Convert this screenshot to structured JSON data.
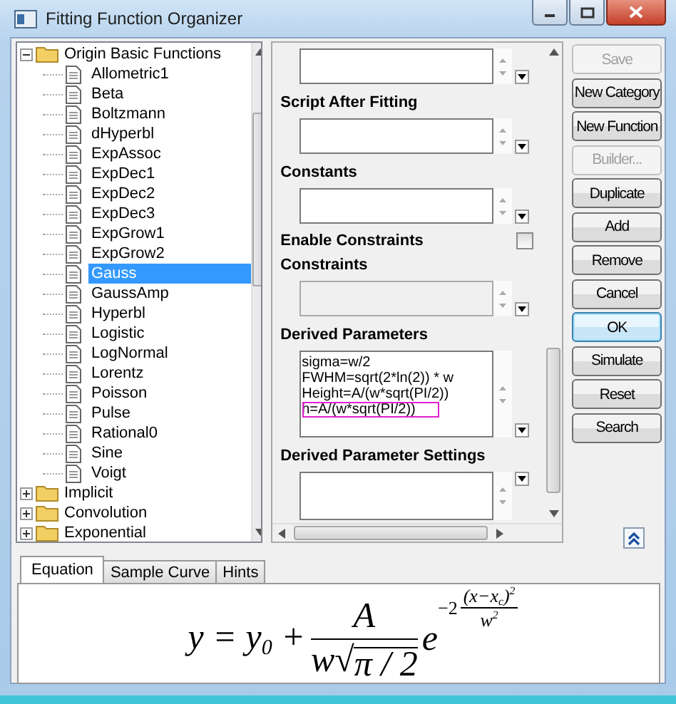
{
  "window": {
    "title": "Fitting Function Organizer"
  },
  "tree": [
    {
      "label": "Origin Basic Functions",
      "kind": "folder",
      "expanded": true,
      "selected": false,
      "children": [
        {
          "label": "Allometric1",
          "kind": "file",
          "selected": false
        },
        {
          "label": "Beta",
          "kind": "file",
          "selected": false
        },
        {
          "label": "Boltzmann",
          "kind": "file",
          "selected": false
        },
        {
          "label": "dHyperbl",
          "kind": "file",
          "selected": false
        },
        {
          "label": "ExpAssoc",
          "kind": "file",
          "selected": false
        },
        {
          "label": "ExpDec1",
          "kind": "file",
          "selected": false
        },
        {
          "label": "ExpDec2",
          "kind": "file",
          "selected": false
        },
        {
          "label": "ExpDec3",
          "kind": "file",
          "selected": false
        },
        {
          "label": "ExpGrow1",
          "kind": "file",
          "selected": false
        },
        {
          "label": "ExpGrow2",
          "kind": "file",
          "selected": false
        },
        {
          "label": "Gauss",
          "kind": "file",
          "selected": true
        },
        {
          "label": "GaussAmp",
          "kind": "file",
          "selected": false
        },
        {
          "label": "Hyperbl",
          "kind": "file",
          "selected": false
        },
        {
          "label": "Logistic",
          "kind": "file",
          "selected": false
        },
        {
          "label": "LogNormal",
          "kind": "file",
          "selected": false
        },
        {
          "label": "Lorentz",
          "kind": "file",
          "selected": false
        },
        {
          "label": "Poisson",
          "kind": "file",
          "selected": false
        },
        {
          "label": "Pulse",
          "kind": "file",
          "selected": false
        },
        {
          "label": "Rational0",
          "kind": "file",
          "selected": false
        },
        {
          "label": "Sine",
          "kind": "file",
          "selected": false
        },
        {
          "label": "Voigt",
          "kind": "file",
          "selected": false
        }
      ]
    },
    {
      "label": "Implicit",
      "kind": "folder",
      "expanded": false,
      "selected": false
    },
    {
      "label": "Convolution",
      "kind": "folder",
      "expanded": false,
      "selected": false
    },
    {
      "label": "Exponential",
      "kind": "folder",
      "expanded": false,
      "selected": false
    }
  ],
  "settings": [
    {
      "kind": "textbox",
      "disabled": false
    },
    {
      "kind": "heading",
      "label": "Script After Fitting"
    },
    {
      "kind": "textbox",
      "disabled": false
    },
    {
      "kind": "heading",
      "label": "Constants"
    },
    {
      "kind": "textbox",
      "disabled": false
    },
    {
      "kind": "checkbox",
      "label": "Enable Constraints",
      "checked": false
    },
    {
      "kind": "heading",
      "label": "Constraints"
    },
    {
      "kind": "textbox",
      "disabled": true
    },
    {
      "kind": "heading",
      "label": "Derived Parameters"
    },
    {
      "kind": "textbox",
      "disabled": false,
      "lines": [
        {
          "text": "sigma=w/2",
          "highlighted": false
        },
        {
          "text": "FWHM=sqrt(2*ln(2)) * w",
          "highlighted": false
        },
        {
          "text": "Height=A/(w*sqrt(PI/2))",
          "highlighted": false
        },
        {
          "text": "h=A/(w*sqrt(PI/2))",
          "highlighted": true
        }
      ]
    },
    {
      "kind": "heading",
      "label": "Derived Parameter Settings"
    },
    {
      "kind": "textbox",
      "disabled": false
    }
  ],
  "buttons": [
    {
      "label": "Save",
      "disabled": true,
      "default": false
    },
    {
      "label": "New Category",
      "disabled": false,
      "default": false
    },
    {
      "label": "New Function",
      "disabled": false,
      "default": false
    },
    {
      "label": "Builder...",
      "disabled": true,
      "default": false
    },
    {
      "label": "Duplicate",
      "disabled": false,
      "default": false
    },
    {
      "label": "Add",
      "disabled": false,
      "default": false
    },
    {
      "label": "Remove",
      "disabled": false,
      "default": false
    },
    {
      "label": "Cancel",
      "disabled": false,
      "default": false
    },
    {
      "label": "OK",
      "disabled": false,
      "default": true
    },
    {
      "label": "Simulate",
      "disabled": false,
      "default": false
    },
    {
      "label": "Reset",
      "disabled": false,
      "default": false
    },
    {
      "label": "Search",
      "disabled": false,
      "default": false
    }
  ],
  "tabs": [
    {
      "label": "Equation",
      "selected": true
    },
    {
      "label": "Sample Curve",
      "selected": false
    },
    {
      "label": "Hints",
      "selected": false
    }
  ],
  "equation": {
    "lhs": "y = y$_{0}$ +",
    "numerator": "A",
    "denominator_factor": "w",
    "radical": "√",
    "radicand": "π / 2",
    "base": "e",
    "exponent_factor": "−2",
    "exponent_numerator": "(x−x$_{c}$)$^{2}$",
    "exponent_denominator": "w$^{2}$"
  }
}
